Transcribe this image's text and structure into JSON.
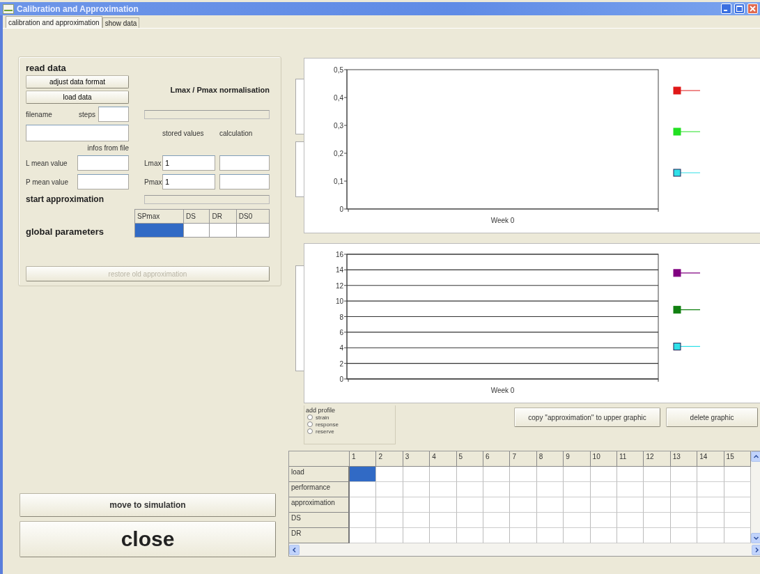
{
  "window": {
    "title": "Calibration and Approximation"
  },
  "tabs": [
    {
      "label": "calibration and approximation",
      "selected": true
    },
    {
      "label": "show data",
      "selected": false
    }
  ],
  "read_data": {
    "heading": "read data",
    "buttons": [
      "adjust data format",
      "load data"
    ],
    "filename_label": "filename",
    "steps_label": "steps",
    "info_label": "infos from file",
    "mean_labels": [
      "L mean value",
      "P mean value"
    ],
    "start_label": "start approximation",
    "restore_button": {
      "label": "restore old approximation",
      "disabled": true
    }
  },
  "normalisation": {
    "title": "Lmax / Pmax normalisation",
    "stored_label": "stored values",
    "calculation_label": "calculation",
    "rows": [
      {
        "label": "Lmax",
        "stored": "1"
      },
      {
        "label": "Pmax",
        "stored": "1"
      }
    ]
  },
  "global_parameters": {
    "label": "global parameters",
    "columns": [
      "SPmax",
      "DS",
      "DR",
      "DS0"
    ],
    "cells": [
      {
        "selected": true
      },
      {
        "selected": false
      },
      {
        "selected": false
      },
      {
        "selected": false
      }
    ]
  },
  "move_button": "move to simulation",
  "close_button": "close",
  "charts": [
    {
      "chart_data": {
        "type": "line",
        "grid": false,
        "categories": [
          "Week 0"
        ],
        "ylim": [
          0,
          0.5
        ],
        "yticks": [
          {
            "value": 0,
            "label": "0"
          },
          {
            "value": 0.1,
            "label": "0,1"
          },
          {
            "value": 0.2,
            "label": "0,2"
          },
          {
            "value": 0.3,
            "label": "0,3"
          },
          {
            "value": 0.4,
            "label": "0,4"
          },
          {
            "value": 0.5,
            "label": "0,5"
          }
        ],
        "series": [
          {
            "color": "#e01818",
            "values": [
              null
            ]
          },
          {
            "color": "#22e022",
            "values": [
              null
            ]
          },
          {
            "color": "#30e0e8",
            "values": [
              null
            ]
          }
        ]
      }
    },
    {
      "chart_data": {
        "type": "line",
        "grid": true,
        "categories": [
          "Week 0"
        ],
        "ylim": [
          0,
          16
        ],
        "yticks": [
          0,
          2,
          4,
          6,
          8,
          10,
          12,
          14,
          16
        ],
        "series": [
          {
            "color": "#800080",
            "values": [
              null
            ]
          },
          {
            "color": "#108010",
            "values": [
              null
            ]
          },
          {
            "color": "#30e0e8",
            "values": [
              null
            ]
          }
        ]
      }
    }
  ],
  "add_profile": {
    "title": "add profile",
    "options": [
      {
        "label": "strain",
        "selected": false
      },
      {
        "label": "response",
        "selected": false
      },
      {
        "label": "reserve",
        "selected": false
      }
    ]
  },
  "actions": [
    "copy ''approximation'' to upper graphic",
    "delete graphic"
  ],
  "table": {
    "columns": [
      "1",
      "2",
      "3",
      "4",
      "5",
      "6",
      "7",
      "8",
      "9",
      "10",
      "11",
      "12",
      "13",
      "14",
      "15"
    ],
    "rows": [
      {
        "label": "load",
        "cells": [
          {
            "selected": true
          },
          {
            "selected": false
          },
          {
            "selected": false
          },
          {
            "selected": false
          },
          {
            "selected": false
          },
          {
            "selected": false
          },
          {
            "selected": false
          },
          {
            "selected": false
          },
          {
            "selected": false
          },
          {
            "selected": false
          },
          {
            "selected": false
          },
          {
            "selected": false
          },
          {
            "selected": false
          },
          {
            "selected": false
          },
          {
            "selected": false
          }
        ]
      },
      {
        "label": "performance",
        "cells": [
          {
            "selected": false
          },
          {
            "selected": false
          },
          {
            "selected": false
          },
          {
            "selected": false
          },
          {
            "selected": false
          },
          {
            "selected": false
          },
          {
            "selected": false
          },
          {
            "selected": false
          },
          {
            "selected": false
          },
          {
            "selected": false
          },
          {
            "selected": false
          },
          {
            "selected": false
          },
          {
            "selected": false
          },
          {
            "selected": false
          },
          {
            "selected": false
          }
        ]
      },
      {
        "label": "approximation",
        "cells": [
          {
            "selected": false
          },
          {
            "selected": false
          },
          {
            "selected": false
          },
          {
            "selected": false
          },
          {
            "selected": false
          },
          {
            "selected": false
          },
          {
            "selected": false
          },
          {
            "selected": false
          },
          {
            "selected": false
          },
          {
            "selected": false
          },
          {
            "selected": false
          },
          {
            "selected": false
          },
          {
            "selected": false
          },
          {
            "selected": false
          },
          {
            "selected": false
          }
        ]
      },
      {
        "label": "DS",
        "cells": [
          {
            "selected": false
          },
          {
            "selected": false
          },
          {
            "selected": false
          },
          {
            "selected": false
          },
          {
            "selected": false
          },
          {
            "selected": false
          },
          {
            "selected": false
          },
          {
            "selected": false
          },
          {
            "selected": false
          },
          {
            "selected": false
          },
          {
            "selected": false
          },
          {
            "selected": false
          },
          {
            "selected": false
          },
          {
            "selected": false
          },
          {
            "selected": false
          }
        ]
      },
      {
        "label": "DR",
        "cells": [
          {
            "selected": false
          },
          {
            "selected": false
          },
          {
            "selected": false
          },
          {
            "selected": false
          },
          {
            "selected": false
          },
          {
            "selected": false
          },
          {
            "selected": false
          },
          {
            "selected": false
          },
          {
            "selected": false
          },
          {
            "selected": false
          },
          {
            "selected": false
          },
          {
            "selected": false
          },
          {
            "selected": false
          },
          {
            "selected": false
          },
          {
            "selected": false
          }
        ]
      }
    ]
  }
}
